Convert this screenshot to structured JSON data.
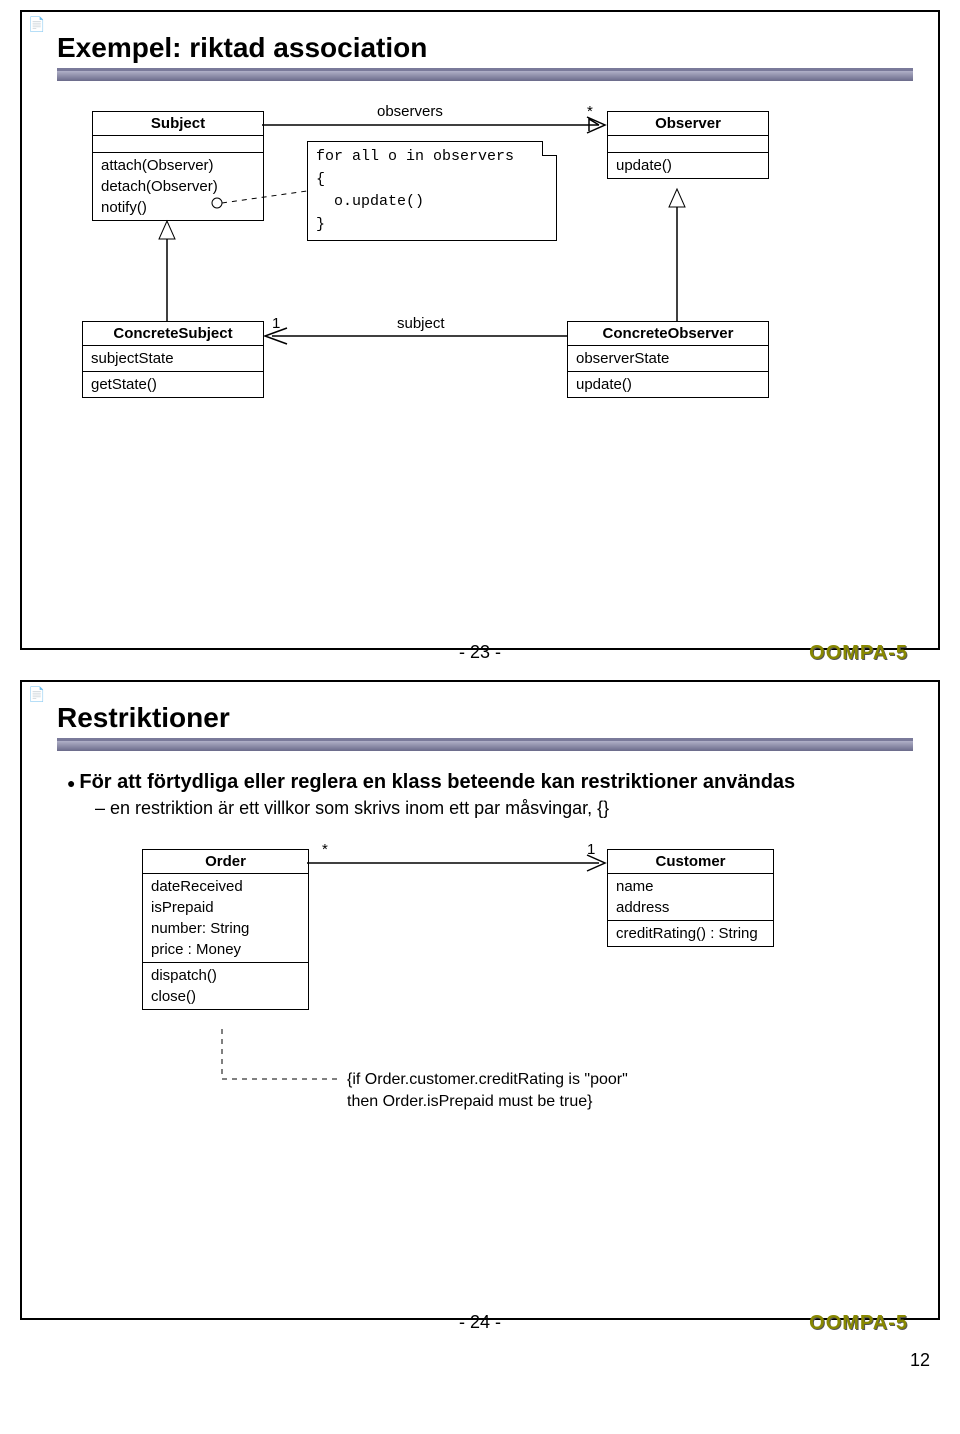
{
  "slide1": {
    "title": "Exempel: riktad association",
    "subject": {
      "name": "Subject",
      "ops": [
        "attach(Observer)",
        "detach(Observer)",
        "notify()"
      ]
    },
    "observer": {
      "name": "Observer",
      "ops": [
        "update()"
      ]
    },
    "note": {
      "l1": "for all o in observers",
      "l2": "{",
      "l3": "  o.update()",
      "l4": "}"
    },
    "concreteSubject": {
      "name": "ConcreteSubject",
      "attrs": [
        "subjectState"
      ],
      "ops": [
        "getState()"
      ]
    },
    "concreteObserver": {
      "name": "ConcreteObserver",
      "attrs": [
        "observerState"
      ],
      "ops": [
        "update()"
      ]
    },
    "assoc_label": "observers",
    "assoc_mult": "*",
    "subject_label": "subject",
    "subject_mult": "1",
    "page": "- 23 -",
    "brand": "OOMPA-5"
  },
  "slide2": {
    "title": "Restriktioner",
    "bullet": "För att förtydliga eller reglera en klass beteende kan restriktioner användas",
    "subbullet": "en restriktion är ett villkor som skrivs inom ett par måsvingar, {}",
    "order": {
      "name": "Order",
      "attrs": [
        "dateReceived",
        "isPrepaid",
        "number: String",
        "price : Money"
      ],
      "ops": [
        "dispatch()",
        "close()"
      ]
    },
    "customer": {
      "name": "Customer",
      "attrs": [
        "name",
        "address"
      ],
      "ops": [
        "creditRating() : String"
      ]
    },
    "mult_left": "*",
    "mult_right": "1",
    "constraint": {
      "l1": "{if Order.customer.creditRating is \"poor\"",
      "l2": "then Order.isPrepaid must be true}"
    },
    "page": "- 24 -",
    "brand": "OOMPA-5"
  },
  "page_number": "12"
}
